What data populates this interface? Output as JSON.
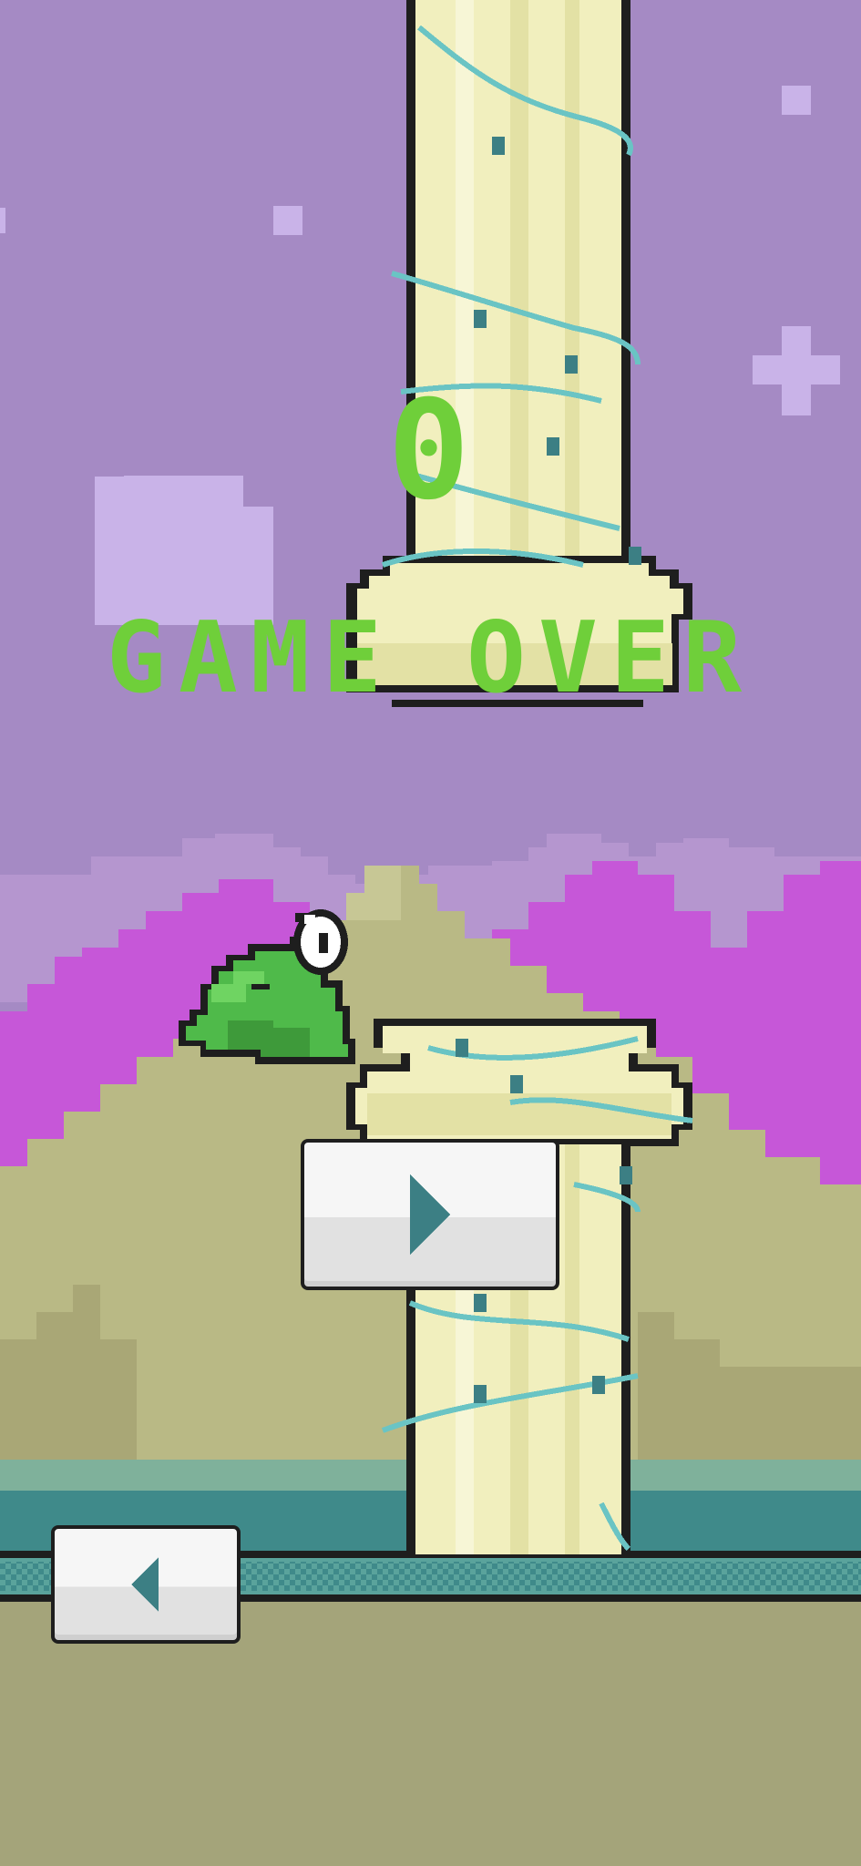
{
  "game": {
    "score": "0",
    "status": "GAME OVER",
    "play_button": {
      "icon": "play-triangle-icon"
    },
    "back_button": {
      "icon": "back-triangle-icon"
    }
  },
  "colors": {
    "sky": "#a58ac4",
    "text_green": "#6fcf3a",
    "mountain_magenta": "#c657d8",
    "hill": "#b9b985",
    "ground": "#a4a47a",
    "water": "#3f8a8a",
    "pillar": "#f1efbe",
    "vine": "#6ac4c4",
    "frog": "#4fba4a",
    "button_icon": "#3c7f84"
  }
}
